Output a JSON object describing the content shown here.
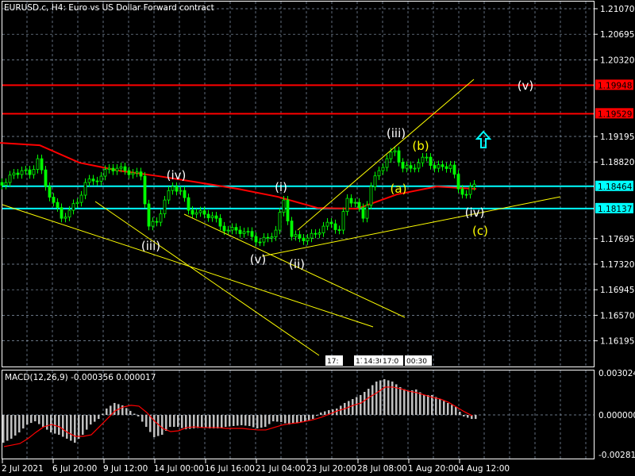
{
  "window": {
    "title": "EURUSD.c, H4:  Euro vs US Dollar Forward contract"
  },
  "colors": {
    "background": "#000000",
    "candle": "#00ff00",
    "ma": "#ff0000",
    "support": "#00ffff",
    "resistance": "#ff0000",
    "trend": "#ffff00",
    "grid": "#8a9bb0",
    "macd_hist": "#c0c0c0",
    "macd_signal": "#ff0000"
  },
  "price_axis": {
    "labels": [
      "1.21070",
      "1.20695",
      "1.20320",
      "1.19195",
      "1.18820",
      "1.17695",
      "1.17320",
      "1.16945",
      "1.16570",
      "1.16195"
    ]
  },
  "levels": [
    {
      "label": "1.19948",
      "price": 1.19948,
      "kind": "resistance"
    },
    {
      "label": "1.19529",
      "price": 1.19529,
      "kind": "resistance"
    },
    {
      "label": "1.18464",
      "price": 1.18464,
      "kind": "support"
    },
    {
      "label": "1.18137",
      "price": 1.18137,
      "kind": "support"
    }
  ],
  "time_axis": {
    "labels": [
      "2 Jul 2021",
      "6 Jul 20:00",
      "9 Jul 12:00",
      "14 Jul 00:00",
      "16 Jul 16:00",
      "21 Jul 04:00",
      "23 Jul 20:00",
      "28 Jul 08:00",
      "1 Aug 20:00",
      "4 Aug 12:00"
    ]
  },
  "time_markers": [
    "17:",
    "17 0",
    "14:30",
    "17:0",
    "00:30"
  ],
  "wave_labels": [
    {
      "text": "(v)",
      "color": "white"
    },
    {
      "text": "(iii)",
      "color": "white"
    },
    {
      "text": "(b)",
      "color": "yellow"
    },
    {
      "text": "(iv)",
      "color": "white"
    },
    {
      "text": "(i)",
      "color": "white"
    },
    {
      "text": "(a)",
      "color": "yellow"
    },
    {
      "text": "(iv)",
      "color": "white"
    },
    {
      "text": "(c)",
      "color": "yellow"
    },
    {
      "text": "(iii)",
      "color": "white"
    },
    {
      "text": "(v)",
      "color": "white"
    },
    {
      "text": "(ii)",
      "color": "white"
    }
  ],
  "macd": {
    "label": "MACD(12,26,9) -0.000356 0.000017",
    "axis_labels": [
      "0.003024",
      "0.000000",
      "-0.002812"
    ]
  },
  "chart_data": {
    "type": "line",
    "title": "EURUSD.c, H4",
    "ylim": [
      1.16,
      1.2115
    ],
    "closes": [
      1.18519,
      1.18658,
      1.18693,
      1.18635,
      1.18868,
      1.1846,
      1.18227,
      1.17994,
      1.18111,
      1.18227,
      1.18519,
      1.18542,
      1.18612,
      1.18728,
      1.18728,
      1.18693,
      1.18658,
      1.18612,
      1.17878,
      1.17936,
      1.18262,
      1.1846,
      1.18402,
      1.18111,
      1.18076,
      1.18053,
      1.18029,
      1.17878,
      1.1782,
      1.1782,
      1.17796,
      1.17726,
      1.17645,
      1.17703,
      1.1782,
      1.18262,
      1.17726,
      1.17703,
      1.17703,
      1.17761,
      1.17878,
      1.17913,
      1.1782,
      1.18286,
      1.18227,
      1.17994,
      1.1846,
      1.18693,
      1.18868,
      1.18985,
      1.18728,
      1.18728,
      1.1881,
      1.18891,
      1.18728,
      1.18752,
      1.18775,
      1.18425,
      1.18344,
      1.18495
    ],
    "moving_average": [
      1.19101,
      1.19066,
      1.1881,
      1.18693,
      1.18612,
      1.18519,
      1.18425,
      1.18309,
      1.18146,
      1.18134,
      1.18344,
      1.1846,
      1.18425
    ],
    "macd_hist": [
      -0.002,
      -0.00171,
      -0.00126,
      -0.00069,
      -0.00046,
      -0.00086,
      -0.00126,
      -0.00143,
      -0.00171,
      -0.002,
      -0.00143,
      -0.00069,
      -0.00029,
      0.00046,
      0.00086,
      0.00069,
      0.00029,
      -0.00011,
      -0.00086,
      -0.0016,
      -0.00143,
      -0.00086,
      -0.00086,
      -0.00103,
      -0.00097,
      -0.00091,
      -0.00097,
      -0.00097,
      -0.00086,
      -0.0008,
      -0.00074,
      -0.0008,
      -0.00097,
      -0.00086,
      -0.00046,
      -0.00051,
      -0.00069,
      -0.00057,
      -0.00046,
      -0.00029,
      0.00017,
      0.00034,
      0.00046,
      0.00086,
      0.00114,
      0.00143,
      0.00188,
      0.0024,
      0.00257,
      0.0024,
      0.002,
      0.00171,
      0.00183,
      0.00143,
      0.00143,
      0.00114,
      0.00086,
      0.00057,
      -0.00011,
      -0.00029
    ],
    "macd_signal": [
      -0.00228,
      -0.00217,
      -0.00206,
      -0.00171,
      -0.00126,
      -0.00086,
      -0.00069,
      -0.00086,
      -0.00126,
      -0.00154,
      -0.00154,
      -0.00143,
      -0.00086,
      -0.00029,
      0.00029,
      0.00057,
      0.00069,
      0.00063,
      0.00017,
      -0.00046,
      -0.00097,
      -0.0012,
      -0.00114,
      -0.00091,
      -0.00086,
      -0.00091,
      -0.00091,
      -0.00091,
      -0.00097,
      -0.00097,
      -0.00097,
      -0.00103,
      -0.00108,
      -0.00108,
      -0.00091,
      -0.00074,
      -0.00063,
      -0.00057,
      -0.00046,
      -0.00034,
      -0.00017,
      6e-05,
      0.00029,
      0.00046,
      0.00069,
      0.00086,
      0.00126,
      0.0016,
      0.002,
      0.002,
      0.00188,
      0.00171,
      0.0016,
      0.00143,
      0.00126,
      0.00114,
      0.00091,
      0.00057,
      0.00023,
      -6e-05
    ],
    "macd_ylim": [
      -0.002812,
      0.003024
    ]
  }
}
